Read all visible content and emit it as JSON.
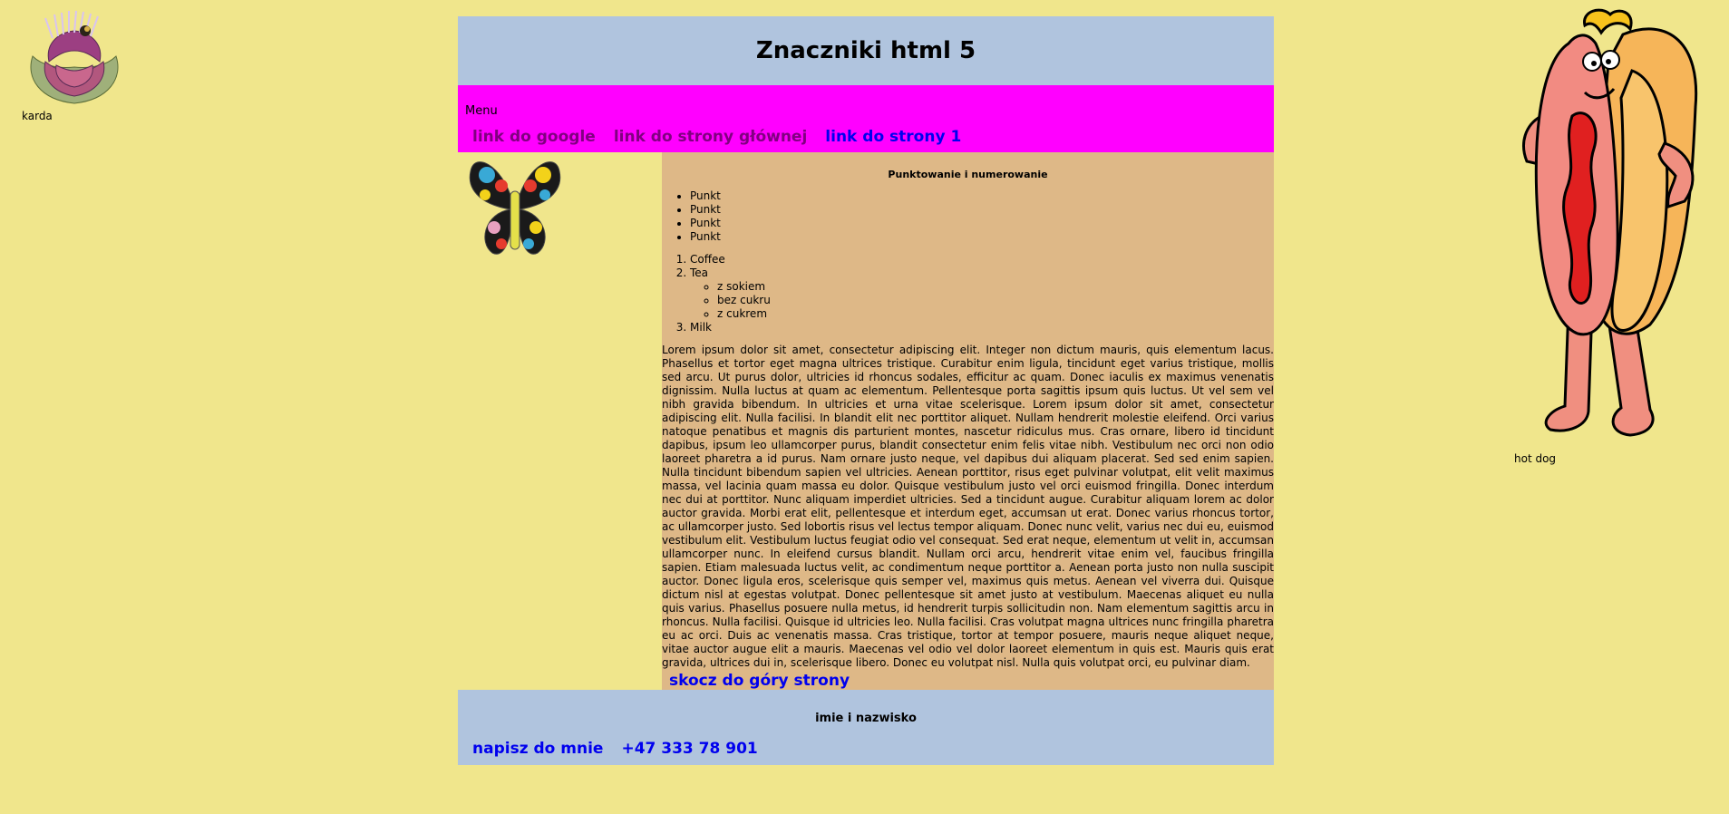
{
  "page": {
    "header_title": "Znaczniki html 5",
    "left_image_caption": "karda",
    "right_image_caption": "hot dog"
  },
  "nav": {
    "menu_label": "Menu",
    "links": [
      {
        "label": "link do google",
        "state": "visited"
      },
      {
        "label": "link do strony głównej",
        "state": "visited"
      },
      {
        "label": "link do strony 1",
        "state": "unvisited"
      }
    ]
  },
  "main": {
    "heading": "Punktowanie i numerowanie",
    "bullets": [
      "Punkt",
      "Punkt",
      "Punkt",
      "Punkt"
    ],
    "ordered": {
      "item1": "Coffee",
      "item2": "Tea",
      "item2_sub": [
        "z sokiem",
        "bez cukru",
        "z cukrem"
      ],
      "item3": "Milk"
    },
    "lorem": "Lorem ipsum dolor sit amet, consectetur adipiscing elit. Integer non dictum mauris, quis elementum lacus. Phasellus et tortor eget magna ultrices tristique. Curabitur enim ligula, tincidunt eget varius tristique, mollis sed arcu. Ut purus dolor, ultricies id rhoncus sodales, efficitur ac quam. Donec iaculis ex maximus venenatis dignissim. Nulla luctus at quam ac elementum. Pellentesque porta sagittis ipsum quis luctus. Ut vel sem vel nibh gravida bibendum. In ultricies et urna vitae scelerisque. Lorem ipsum dolor sit amet, consectetur adipiscing elit. Nulla facilisi. In blandit elit nec porttitor aliquet. Nullam hendrerit molestie eleifend. Orci varius natoque penatibus et magnis dis parturient montes, nascetur ridiculus mus. Cras ornare, libero id tincidunt dapibus, ipsum leo ullamcorper purus, blandit consectetur enim felis vitae nibh. Vestibulum nec orci non odio laoreet pharetra a id purus. Nam ornare justo neque, vel dapibus dui aliquam placerat. Sed sed enim sapien. Nulla tincidunt bibendum sapien vel ultricies. Aenean porttitor, risus eget pulvinar volutpat, elit velit maximus massa, vel lacinia quam massa eu dolor. Quisque vestibulum justo vel orci euismod fringilla. Donec interdum nec dui at porttitor. Nunc aliquam imperdiet ultricies. Sed a tincidunt augue. Curabitur aliquam lorem ac dolor auctor gravida. Morbi erat elit, pellentesque et interdum eget, accumsan ut erat. Donec varius rhoncus tortor, ac ullamcorper justo. Sed lobortis risus vel lectus tempor aliquam. Donec nunc velit, varius nec dui eu, euismod vestibulum elit. Vestibulum luctus feugiat odio vel consequat. Sed erat neque, elementum ut velit in, accumsan ullamcorper nunc. In eleifend cursus blandit. Nullam orci arcu, hendrerit vitae enim vel, faucibus fringilla sapien. Etiam malesuada luctus velit, ac condimentum neque porttitor a. Aenean porta justo non nulla suscipit auctor. Donec ligula eros, scelerisque quis semper vel, maximus quis metus. Aenean vel viverra dui. Quisque dictum nisl at egestas volutpat. Donec pellentesque sit amet justo at vestibulum. Maecenas aliquet eu nulla quis varius. Phasellus posuere nulla metus, id hendrerit turpis sollicitudin non. Nam elementum sagittis arcu in rhoncus. Nulla facilisi. Quisque id ultricies leo. Nulla facilisi. Cras volutpat magna ultrices nunc fringilla pharetra eu ac orci. Duis ac venenatis massa. Cras tristique, tortor at tempor posuere, mauris neque aliquet neque, vitae auctor augue elit a mauris. Maecenas vel odio vel dolor laoreet elementum in quis est. Mauris quis erat gravida, ultrices dui in, scelerisque libero. Donec eu volutpat nisl. Nulla quis volutpat orci, eu pulvinar diam.",
    "jump_link": "skocz do góry strony"
  },
  "footer": {
    "name": "imie i nazwisko",
    "email_link": "napisz do mnie",
    "phone_link": "+47 333 78 901"
  },
  "colors": {
    "page_bg": "#f0e68c",
    "header_bg": "#b0c4de",
    "nav_bg": "#ff00ff",
    "main_bg": "#deb887",
    "link": "#0000ee",
    "visited_link": "#800080"
  },
  "images": {
    "left": "artichoke-thistle-image",
    "butterfly": "butterfly-image",
    "right": "hot-dog-cartoon-image"
  }
}
